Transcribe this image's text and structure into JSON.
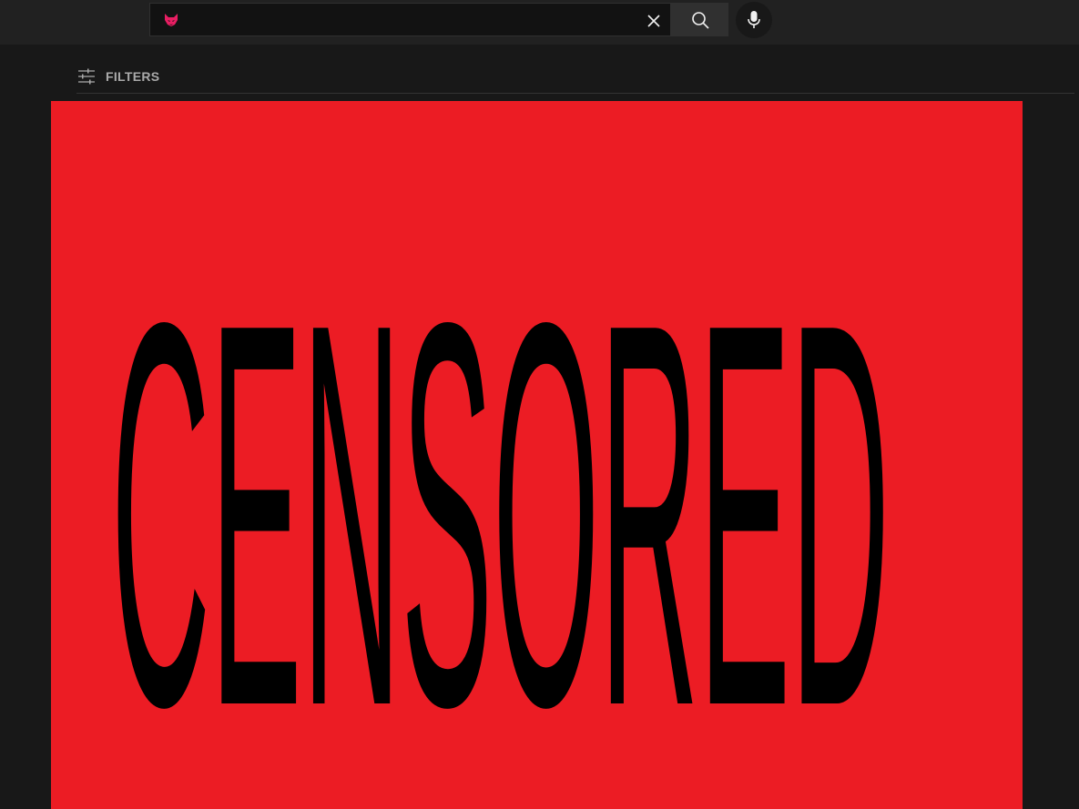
{
  "search": {
    "value": "",
    "placeholder": ""
  },
  "filters": {
    "label": "FILTERS"
  },
  "result": {
    "thumbnail_text": "CENSORED"
  },
  "colors": {
    "background": "#181818",
    "topbar": "#212121",
    "thumbnail_bg": "#ec1c24",
    "thumbnail_text": "#000000",
    "extension_icon": "#e91e63"
  },
  "icons": {
    "extension": "fox-mask-icon",
    "clear": "close-icon",
    "search": "search-icon",
    "mic": "microphone-icon",
    "filters": "sliders-icon"
  }
}
